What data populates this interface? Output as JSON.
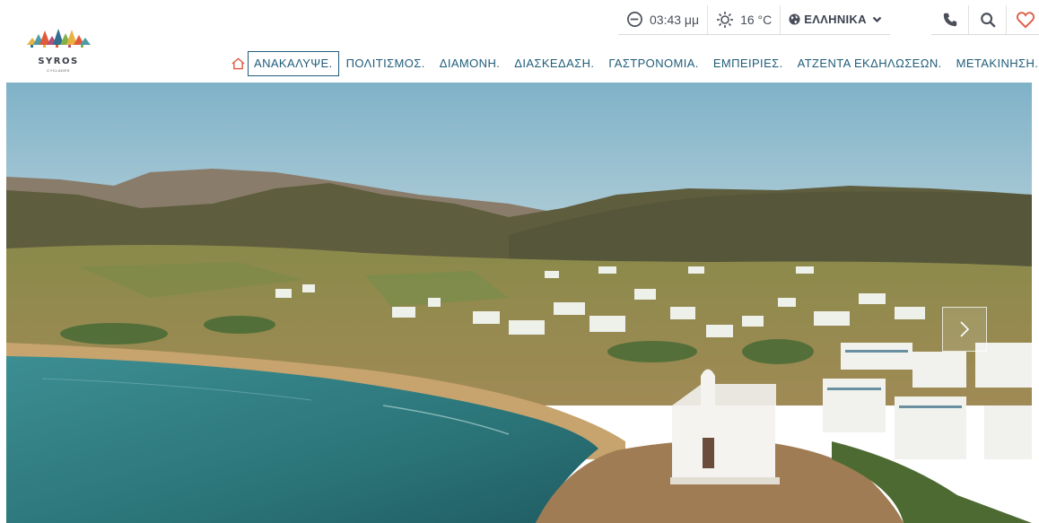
{
  "brand": {
    "name": "SYROS",
    "subtitle": "CYCLADES",
    "colors": [
      "#e05a3b",
      "#e7b23f",
      "#4d9aa8",
      "#2f6f8f",
      "#b24f77",
      "#7fb04a"
    ]
  },
  "utility": {
    "time": "03:43 μμ",
    "time_icon": "clock-icon",
    "temperature": "16 °C",
    "weather_icon": "sun-icon",
    "language": "ΕΛΛΗΝΙΚΑ",
    "language_icon": "globe-icon",
    "phone_icon": "phone-icon",
    "search_icon": "search-icon",
    "favorites_icon": "heart-icon"
  },
  "nav": {
    "home_icon": "home-icon",
    "items": [
      {
        "label": "ΑΝΑΚΑΛΥΨΕ.",
        "active": true
      },
      {
        "label": "ΠΟΛΙΤΙΣΜΟΣ."
      },
      {
        "label": "ΔΙΑΜΟΝΗ."
      },
      {
        "label": "ΔΙΑΣΚΕΔΑΣΗ."
      },
      {
        "label": "ΓΑΣΤΡΟΝΟΜΙΑ."
      },
      {
        "label": "ΕΜΠΕΙΡΙΕΣ."
      },
      {
        "label": "ΑΤΖΕΝΤΑ ΕΚΔΗΛΩΣΕΩΝ."
      },
      {
        "label": "ΜΕΤΑΚΙΝΗΣΗ."
      }
    ]
  },
  "hero": {
    "image": "aerial-photo-bay-with-white-chapel-and-village",
    "next_icon": "chevron-right-icon"
  },
  "colors": {
    "nav_text": "#1f5c7a",
    "heart": "#e0573f",
    "home_icon": "#e0573f",
    "utility_text": "#4a4f5a"
  }
}
